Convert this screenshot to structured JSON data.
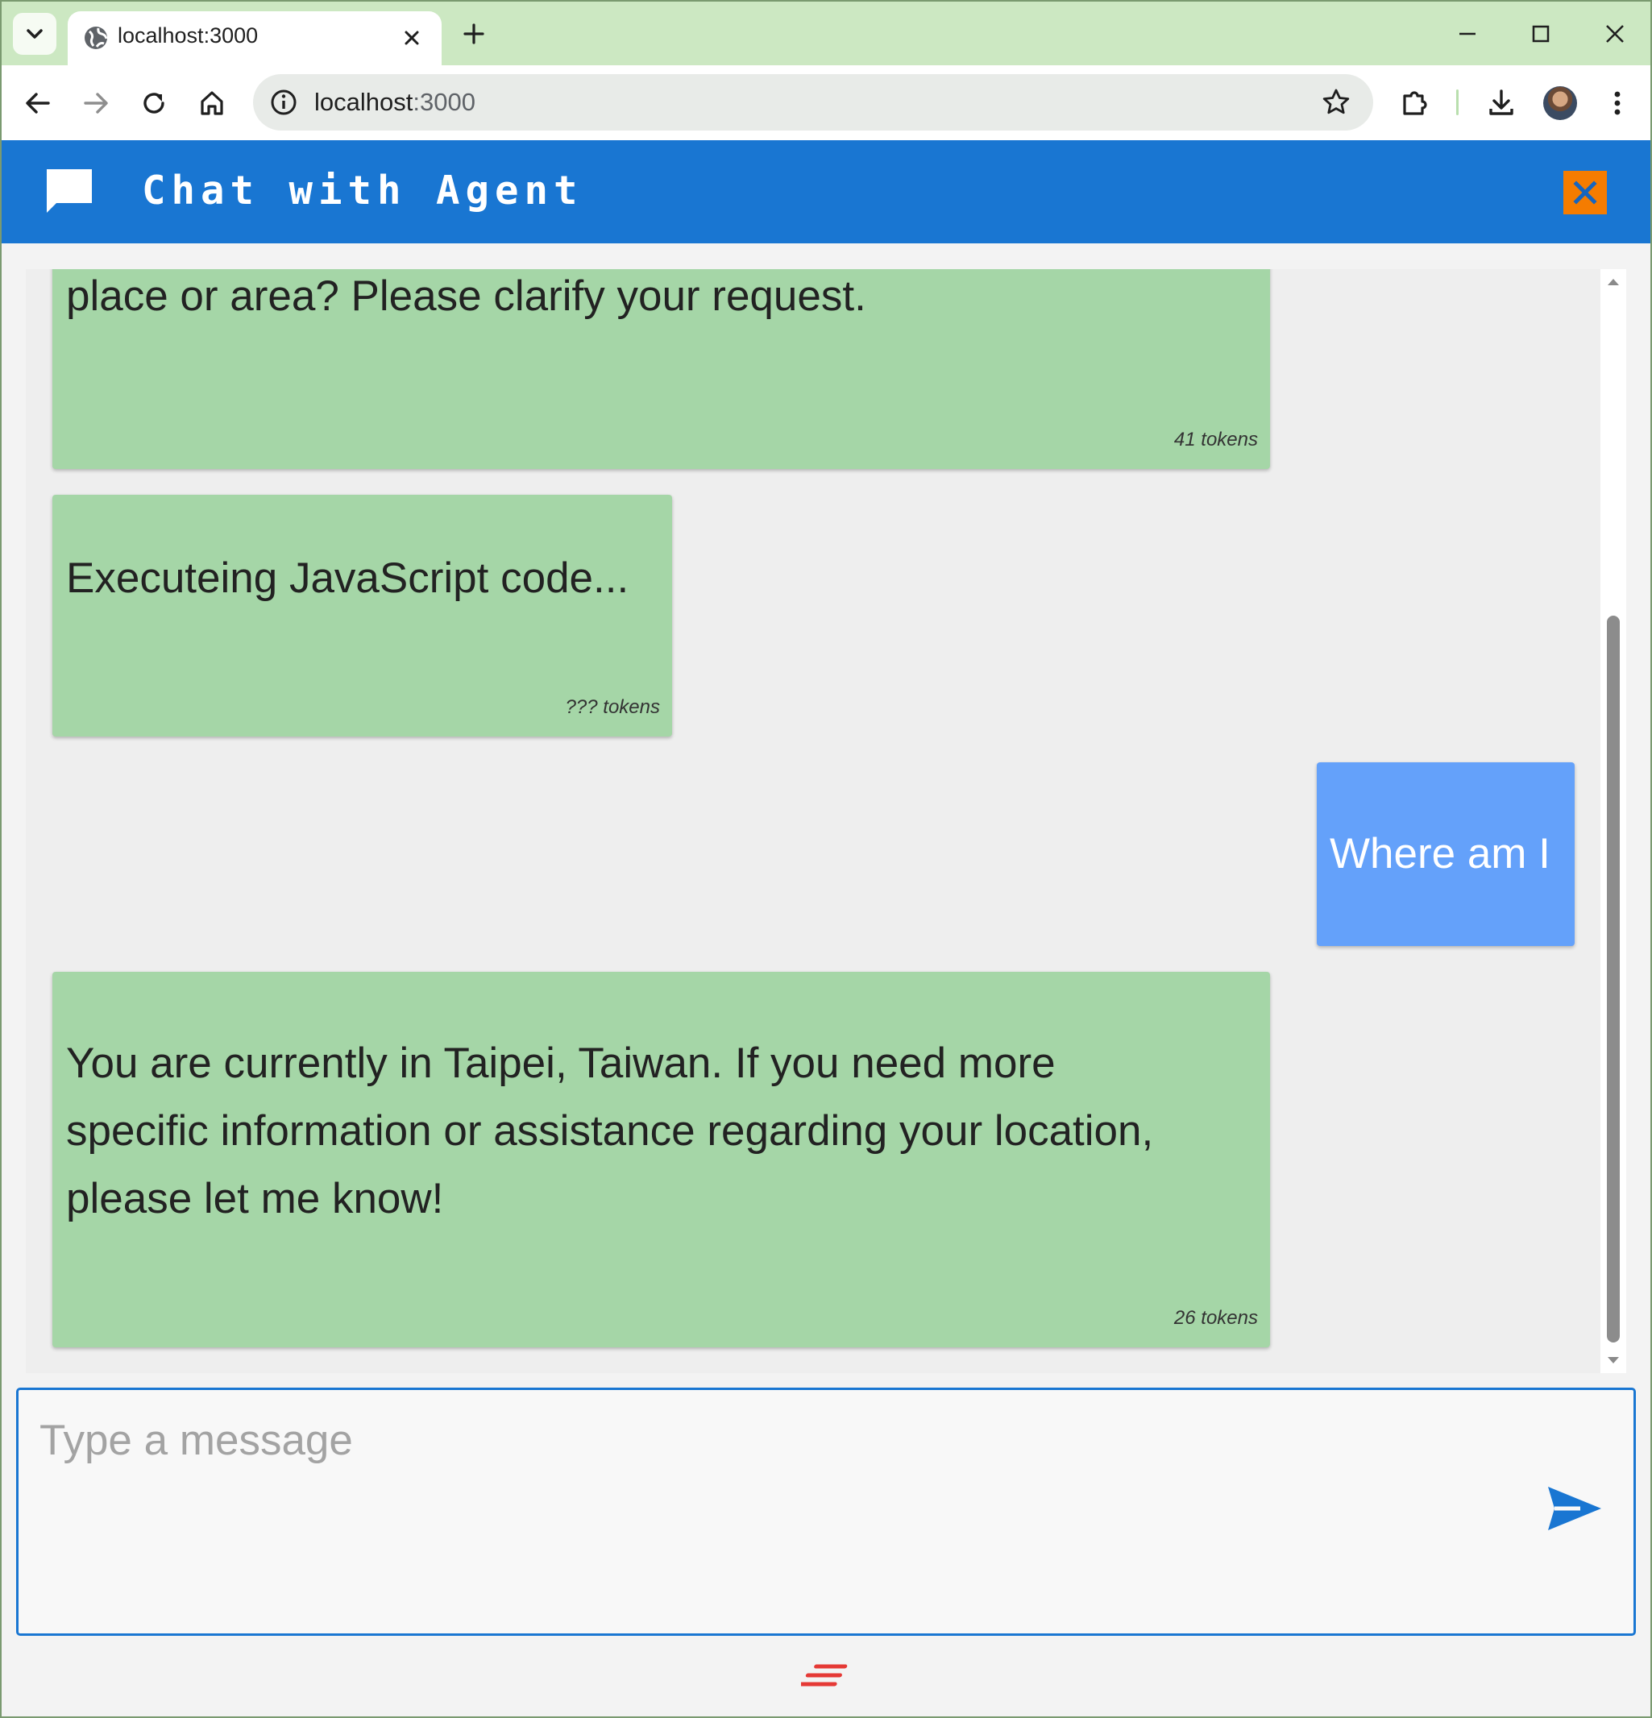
{
  "browser": {
    "tab_title": "localhost:3000",
    "url_host": "localhost",
    "url_port": ":3000"
  },
  "app": {
    "title": "Chat with Agent",
    "accent_color": "#1976d2",
    "close_color": "#f57c00"
  },
  "messages": [
    {
      "role": "agent",
      "text": "place or area? Please clarify your request.",
      "tokens": "41 tokens"
    },
    {
      "role": "agent",
      "text": "Executeing JavaScript code...",
      "tokens": "??? tokens"
    },
    {
      "role": "user",
      "text": "Where am I"
    },
    {
      "role": "agent",
      "lines": [
        "You are currently in Taipei, Taiwan. If you need more",
        "specific information or assistance regarding your location,",
        "please let me know!"
      ],
      "tokens": "26 tokens"
    }
  ],
  "composer": {
    "placeholder": "Type a message"
  },
  "icons": {
    "tab_menu": "chevron-down-icon",
    "tab_favicon": "globe-icon",
    "tab_close": "close-icon",
    "new_tab": "plus-icon",
    "back": "arrow-left-icon",
    "forward": "arrow-right-icon",
    "reload": "reload-icon",
    "home": "home-icon",
    "site_info": "info-icon",
    "bookmark": "star-icon",
    "extensions": "puzzle-icon",
    "downloads": "download-icon",
    "menu": "kebab-menu-icon",
    "chat_logo": "chat-bubble-icon",
    "send": "send-icon",
    "footer": "stripes-logo-icon"
  }
}
